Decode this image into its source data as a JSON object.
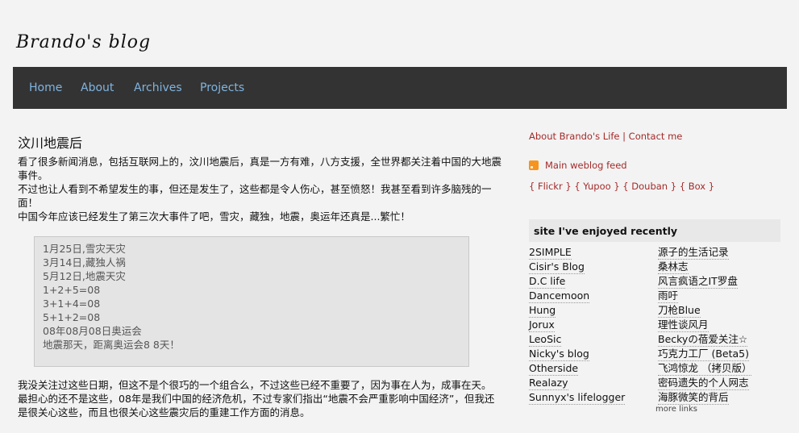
{
  "blog_title": "Brando's blog",
  "nav": [
    "Home",
    "About",
    "Archives",
    "Projects"
  ],
  "post": {
    "title": "汶川地震后",
    "para1": "看了很多新闻消息，包括互联网上的，汶川地震后，真是一方有难，八方支援，全世界都关注着中国的大地震事件。",
    "para2": "不过也让人看到不希望发生的事，但还是发生了，这些都是令人伤心，甚至愤怒！我甚至看到许多脑残的一面！",
    "para3": "中国今年应该已经发生了第三次大事件了吧，雪灾，藏独，地震，奥运年还真是...繁忙！",
    "quote": [
      "1月25日,雪灾天灾",
      "3月14日,藏独人祸",
      "5月12日,地震天灾",
      "1+2+5=08",
      "3+1+4=08",
      "5+1+2=08",
      "08年08月08日奥运会",
      "地震那天，距离奥运会8 8天！"
    ],
    "para4": "我没关注过这些日期，但这不是个很巧的一个组合么，不过这些已经不重要了，因为事在人为，成事在天。",
    "para5": "最担心的还不是这些，08年是我们中国的经济危机，不过专家们指出“地震不会严重影响中国经济”，但我还是很关心这些，而且也很关心这些震灾后的重建工作方面的消息。"
  },
  "sidebar": {
    "about_link": "About Brando's Life",
    "separator": "|",
    "contact_link": "Contact me",
    "feed_label": "Main weblog feed",
    "social": [
      "{ Flickr }",
      "{ Yupoo }",
      "{ Douban }",
      "{ Box }"
    ],
    "recent_title": "site I've enjoyed recently",
    "links_left": [
      "2SIMPLE",
      "Cisir's Blog",
      "D.C life",
      "Dancemoon",
      "Hung",
      "Jorux",
      "LeoSic",
      "Nicky's blog",
      "Otherside",
      "Realazy",
      "Sunnyx's lifelogger"
    ],
    "links_right": [
      "源子的生活记录",
      "桑林志",
      "风言疯语之IT罗盘",
      "雨吁",
      "刀枪Blue",
      "理性谈风月",
      "Beckyの蓓爱关注☆",
      "巧克力工厂 (Beta5)",
      "飞鸿惊龙 （拷贝版）",
      "密码遗失的个人网志",
      "海豚微笑的背后"
    ],
    "more_links": "more links"
  },
  "colors": {
    "nav_bg": "#333333",
    "nav_link": "#7fb4e0",
    "sidebar_link": "#a52a2a",
    "rss": "#f7941d"
  }
}
